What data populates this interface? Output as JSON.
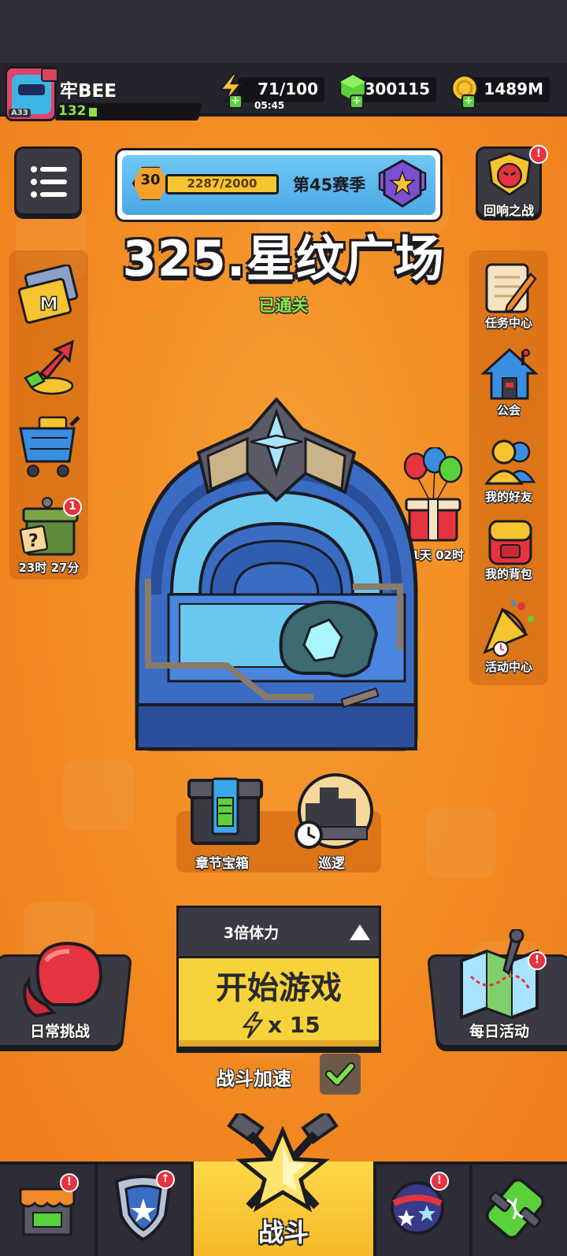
{
  "player": {
    "name": "牢BEE",
    "level": "132",
    "avatar_tag": "A33"
  },
  "resources": {
    "energy": "71/100",
    "energy_timer": "05:45",
    "gems": "300115",
    "gold": "1489M"
  },
  "season": {
    "level": "30",
    "progress": "2287/2000",
    "name": "第45赛季"
  },
  "echo_battle": {
    "label": "回响之战",
    "badge": "!"
  },
  "stage": {
    "title": "325.星纹广场",
    "status": "已通关"
  },
  "left_side": {
    "mystery_box_timer": "23时 27分",
    "mystery_box_badge": "1"
  },
  "right_side": {
    "items": [
      {
        "label": "任务中心"
      },
      {
        "label": "公会"
      },
      {
        "label": "我的好友"
      },
      {
        "label": "我的背包"
      },
      {
        "label": "活动中心"
      }
    ]
  },
  "gift": {
    "timer": "01天 02时"
  },
  "sub_buttons": {
    "chest": "章节宝箱",
    "patrol": "巡逻"
  },
  "start": {
    "multiplier": "3倍体力",
    "label": "开始游戏",
    "cost": "x 15"
  },
  "speedup": {
    "label": "战斗加速",
    "checked": true
  },
  "daily_challenge": {
    "label": "日常挑战"
  },
  "daily_event": {
    "label": "每日活动",
    "badge": "!"
  },
  "bottom_nav": {
    "battle": "战斗",
    "badge": "!",
    "talent_badge": "↑"
  },
  "colors": {
    "background": "#f28a22",
    "accent_yellow": "#f6d33a",
    "dark_panel": "#3a3a44",
    "cleared_green": "#8be54a"
  }
}
